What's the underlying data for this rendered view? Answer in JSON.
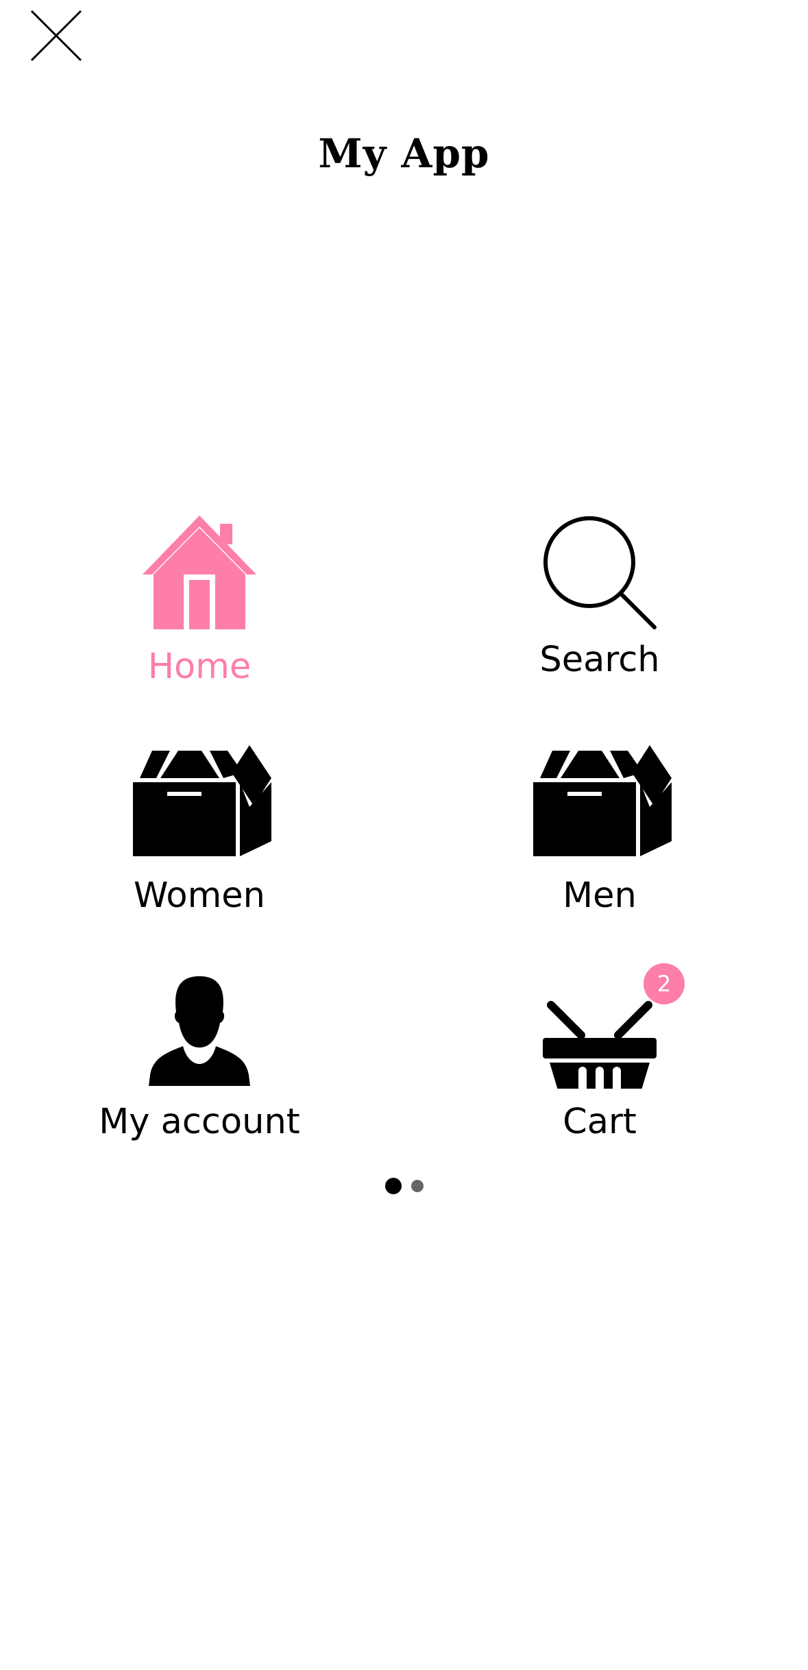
{
  "header": {
    "close_icon": "close-icon",
    "title": "My App"
  },
  "menu": {
    "home": {
      "label": "Home",
      "icon": "home-icon",
      "active": true
    },
    "search": {
      "label": "Search",
      "icon": "search-icon",
      "active": false
    },
    "women": {
      "label": "Women",
      "icon": "box-icon",
      "active": false
    },
    "men": {
      "label": "Men",
      "icon": "box-icon",
      "active": false
    },
    "account": {
      "label": "My account",
      "icon": "user-icon",
      "active": false
    },
    "cart": {
      "label": "Cart",
      "icon": "basket-icon",
      "active": false,
      "badge": "2"
    }
  },
  "pager": {
    "pages": 2,
    "current": 1
  },
  "colors": {
    "accent": "#fd7ea8",
    "text": "#000000",
    "background": "#ffffff",
    "dot_inactive": "#666666"
  }
}
